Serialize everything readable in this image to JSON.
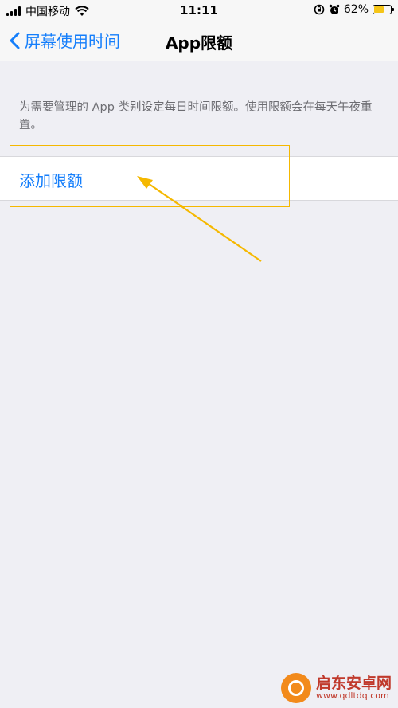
{
  "status_bar": {
    "carrier": "中国移动",
    "time": "11:11",
    "battery": "62%",
    "battery_level": 0.62,
    "icons": [
      "signal-icon",
      "wifi-icon",
      "orientation-lock-icon",
      "alarm-icon",
      "battery-icon"
    ]
  },
  "nav": {
    "back_label": "屏幕使用时间",
    "title": "App限额"
  },
  "content": {
    "description": "为需要管理的 App 类别设定每日时间限额。使用限额会在每天午夜重置。",
    "add_limit_label": "添加限额"
  },
  "watermark": {
    "title": "启东安卓网",
    "url": "www.qdltdq.com"
  },
  "colors": {
    "accent": "#147efb",
    "annotation": "#f5b800",
    "background": "#efeff4"
  }
}
